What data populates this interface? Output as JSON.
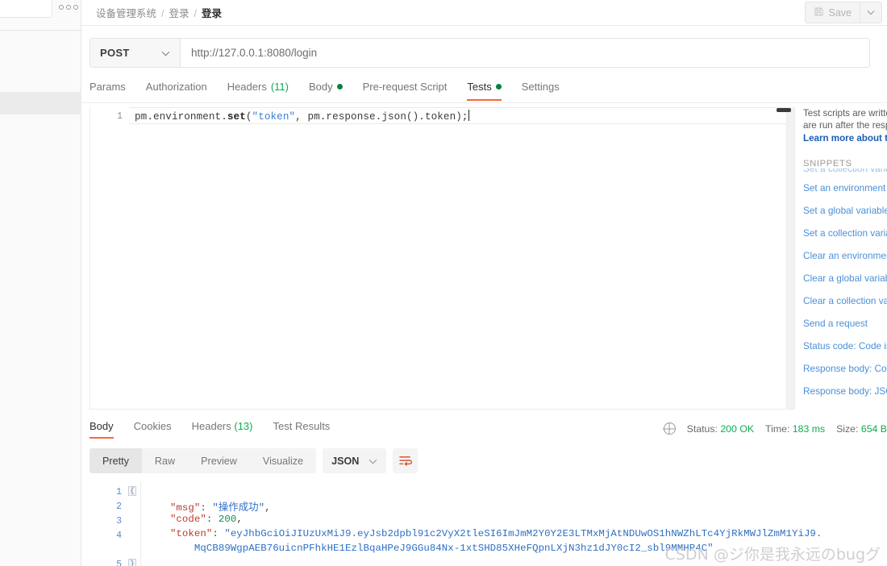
{
  "sidebar": {
    "menu_icon": "more-horizontal-icon"
  },
  "header": {
    "breadcrumb": [
      {
        "label": "设备管理系统",
        "current": false
      },
      {
        "label": "登录",
        "current": false
      },
      {
        "label": "登录",
        "current": true
      }
    ],
    "separator": "/",
    "save_label": "Save",
    "save_icon": "floppy-disk-icon",
    "save_caret_icon": "chevron-down-icon"
  },
  "request": {
    "method": "POST",
    "method_caret_icon": "chevron-down-icon",
    "url": "http://127.0.0.1:8080/login",
    "tabs": [
      {
        "label": "Params",
        "active": false,
        "badge": "",
        "dot": false
      },
      {
        "label": "Authorization",
        "active": false,
        "badge": "",
        "dot": false
      },
      {
        "label": "Headers",
        "active": false,
        "badge": "(11)",
        "dot": false
      },
      {
        "label": "Body",
        "active": false,
        "badge": "",
        "dot": true
      },
      {
        "label": "Pre-request Script",
        "active": false,
        "badge": "",
        "dot": false
      },
      {
        "label": "Tests",
        "active": true,
        "badge": "",
        "dot": true
      },
      {
        "label": "Settings",
        "active": false,
        "badge": "",
        "dot": false
      }
    ]
  },
  "editor": {
    "line_number": "1",
    "code_segments": [
      {
        "text": "pm.environment.",
        "type": "prop"
      },
      {
        "text": "set",
        "type": "fn"
      },
      {
        "text": "(",
        "type": "prop"
      },
      {
        "text": "\"token\"",
        "type": "str"
      },
      {
        "text": ", pm.response.json().token);",
        "type": "prop"
      }
    ],
    "full_code": "pm.environment.set(\"token\", pm.response.json().token);"
  },
  "snippets": {
    "description_line1": "Test scripts are writte",
    "description_line2": "are run after the resp",
    "learn_more": "Learn more about te",
    "title": "SNIPPETS",
    "ghost_item": "Set a collection varia",
    "items": [
      "Set an environment v",
      "Set a global variable",
      "Set a collection varia",
      "Clear an environment",
      "Clear a global variabl",
      "Clear a collection var",
      "Send a request",
      "Status code: Code is",
      "Response body: Con",
      "Response body: JSO"
    ]
  },
  "response": {
    "tabs": [
      {
        "label": "Body",
        "active": true,
        "badge": ""
      },
      {
        "label": "Cookies",
        "active": false,
        "badge": ""
      },
      {
        "label": "Headers",
        "active": false,
        "badge": "(13)"
      },
      {
        "label": "Test Results",
        "active": false,
        "badge": ""
      }
    ],
    "globe_icon": "globe-icon",
    "status_label": "Status:",
    "status_value": "200 OK",
    "time_label": "Time:",
    "time_value": "183 ms",
    "size_label": "Size:",
    "size_value": "654 B",
    "view_modes": [
      {
        "label": "Pretty",
        "active": true
      },
      {
        "label": "Raw",
        "active": false
      },
      {
        "label": "Preview",
        "active": false
      },
      {
        "label": "Visualize",
        "active": false
      }
    ],
    "format": "JSON",
    "format_caret_icon": "chevron-down-icon",
    "reformat_icon": "wrap-lines-icon",
    "json_lines": [
      {
        "n": "1",
        "fold": "{",
        "segments": []
      },
      {
        "n": "2",
        "fold": "",
        "segments": [
          {
            "t": "    \"msg\"",
            "c": "key"
          },
          {
            "t": ": ",
            "c": "punct"
          },
          {
            "t": "\"操作成功\"",
            "c": "str"
          },
          {
            "t": ",",
            "c": "punct"
          }
        ]
      },
      {
        "n": "3",
        "fold": "",
        "segments": [
          {
            "t": "    \"code\"",
            "c": "key"
          },
          {
            "t": ": ",
            "c": "punct"
          },
          {
            "t": "200",
            "c": "num"
          },
          {
            "t": ",",
            "c": "punct"
          }
        ]
      },
      {
        "n": "4",
        "fold": "",
        "segments": [
          {
            "t": "    \"token\"",
            "c": "key"
          },
          {
            "t": ": ",
            "c": "punct"
          },
          {
            "t": "\"eyJhbGciOiJIUzUxMiJ9.eyJsb2dpbl91c2VyX2tleSI6ImJmM2Y0Y2E3LTMxMjAtNDUwOS1hNWZhLTc4YjRkMWJlZmM1YiJ9.",
            "c": "str"
          }
        ]
      },
      {
        "n": "",
        "fold": "",
        "segments": [
          {
            "t": "        MqCB89WgpAEB76uicnPFhkHE1EzlBqaHPeJ9GGu84Nx-1xtSHD85XHeFQpnLXjN3hz1dJY0cI2_sbl9MMHP4C\"",
            "c": "str"
          }
        ]
      },
      {
        "n": "5",
        "fold": "}",
        "segments": []
      }
    ]
  },
  "watermark": "CSDN @ジ你是我永远のbugグ"
}
